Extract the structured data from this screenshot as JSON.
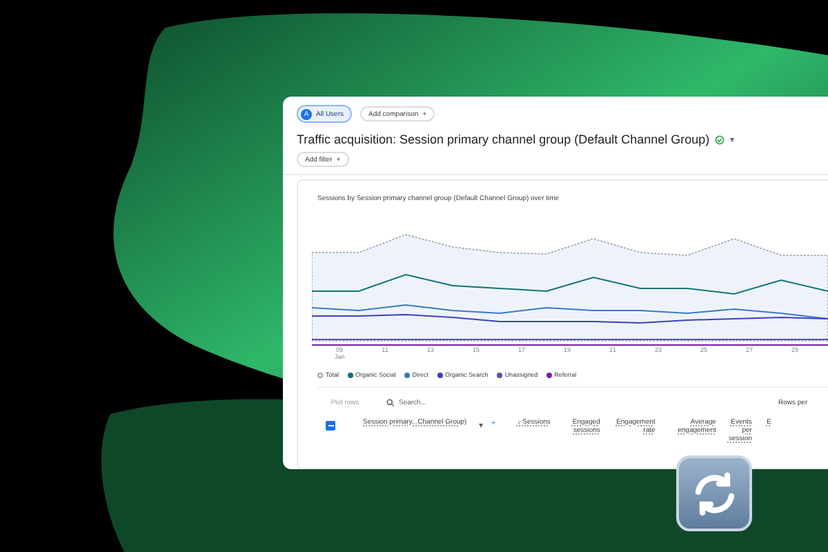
{
  "comparison_bar": {
    "segment": {
      "badge": "A",
      "label": "All Users"
    },
    "add_comparison": {
      "label": "Add comparison",
      "icon": "+"
    }
  },
  "report": {
    "title": "Traffic acquisition: Session primary channel group (Default Channel Group)",
    "caret": "▾",
    "add_filter": {
      "label": "Add filter",
      "icon": "+"
    }
  },
  "chart_card": {
    "title": "Sessions by Session primary channel group (Default Channel Group) over time",
    "x_labels": [
      {
        "day": "09",
        "month": "Jan"
      },
      {
        "day": "11"
      },
      {
        "day": "13"
      },
      {
        "day": "15"
      },
      {
        "day": "17"
      },
      {
        "day": "19"
      },
      {
        "day": "21"
      },
      {
        "day": "23"
      },
      {
        "day": "25"
      },
      {
        "day": "27"
      },
      {
        "day": "29"
      }
    ],
    "legend": [
      {
        "label": "Total",
        "color": "#9aa0a6",
        "hollow": true
      },
      {
        "label": "Organic Social",
        "color": "#12737a",
        "hollow": false
      },
      {
        "label": "Direct",
        "color": "#3a78c9",
        "hollow": false
      },
      {
        "label": "Organic Search",
        "color": "#3f3fbf",
        "hollow": false
      },
      {
        "label": "Unassigned",
        "color": "#5a4fb0",
        "hollow": false
      },
      {
        "label": "Referral",
        "color": "#7b1fa2",
        "hollow": false
      }
    ]
  },
  "table": {
    "plot_rows": "Plot rows",
    "search_placeholder": "Search...",
    "rows_per_page": "Rows per",
    "select_all": {
      "checked": true
    },
    "dimension": {
      "label": "Session primary...Channel Group)",
      "caret": "▾",
      "add": "+"
    },
    "columns": [
      {
        "label": "Sessions",
        "sort": "↓"
      },
      {
        "label": "Engaged sessions"
      },
      {
        "label": "Engagement rate"
      },
      {
        "label": "Average engagement"
      },
      {
        "label": "Events per session"
      },
      {
        "label": "E"
      }
    ]
  }
}
